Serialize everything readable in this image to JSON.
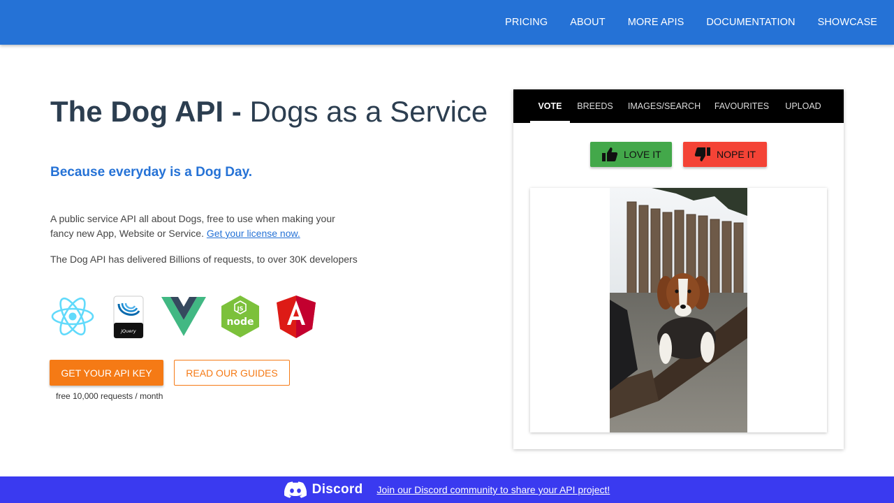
{
  "nav": {
    "items": [
      "PRICING",
      "ABOUT",
      "MORE APIS",
      "DOCUMENTATION",
      "SHOWCASE"
    ]
  },
  "hero": {
    "title_strong": "The Dog API -",
    "title_light": "Dogs as a Service",
    "tagline": "Because everyday is a Dog Day.",
    "description": "A public service API all about Dogs, free to use when making your fancy new App, Website or Service.",
    "license_link": "Get your license now.",
    "stats": "The Dog API has delivered Billions of requests, to over 30K developers"
  },
  "logos": {
    "items": [
      "react-logo",
      "jquery-logo",
      "vue-logo",
      "nodejs-logo",
      "angular-logo"
    ],
    "jquery_text": "jQuery",
    "node_text": "node",
    "js_badge": "JS"
  },
  "cta": {
    "primary_label": "GET YOUR API KEY",
    "secondary_label": "READ OUR GUIDES",
    "note": "free 10,000 requests / month"
  },
  "widget": {
    "tabs": [
      "VOTE",
      "BREEDS",
      "IMAGES/SEARCH",
      "FAVOURITES",
      "UPLOAD"
    ],
    "active_tab": "VOTE",
    "love_label": "LOVE IT",
    "nope_label": "NOPE IT"
  },
  "footer": {
    "brand": "Discord",
    "link_text": "Join our Discord community to share your API project!"
  },
  "colors": {
    "primary_blue": "#2572d6",
    "orange": "#f57a15",
    "love_green": "#43a84a",
    "nope_red": "#f44336",
    "footer_blue": "#3a3af0"
  }
}
